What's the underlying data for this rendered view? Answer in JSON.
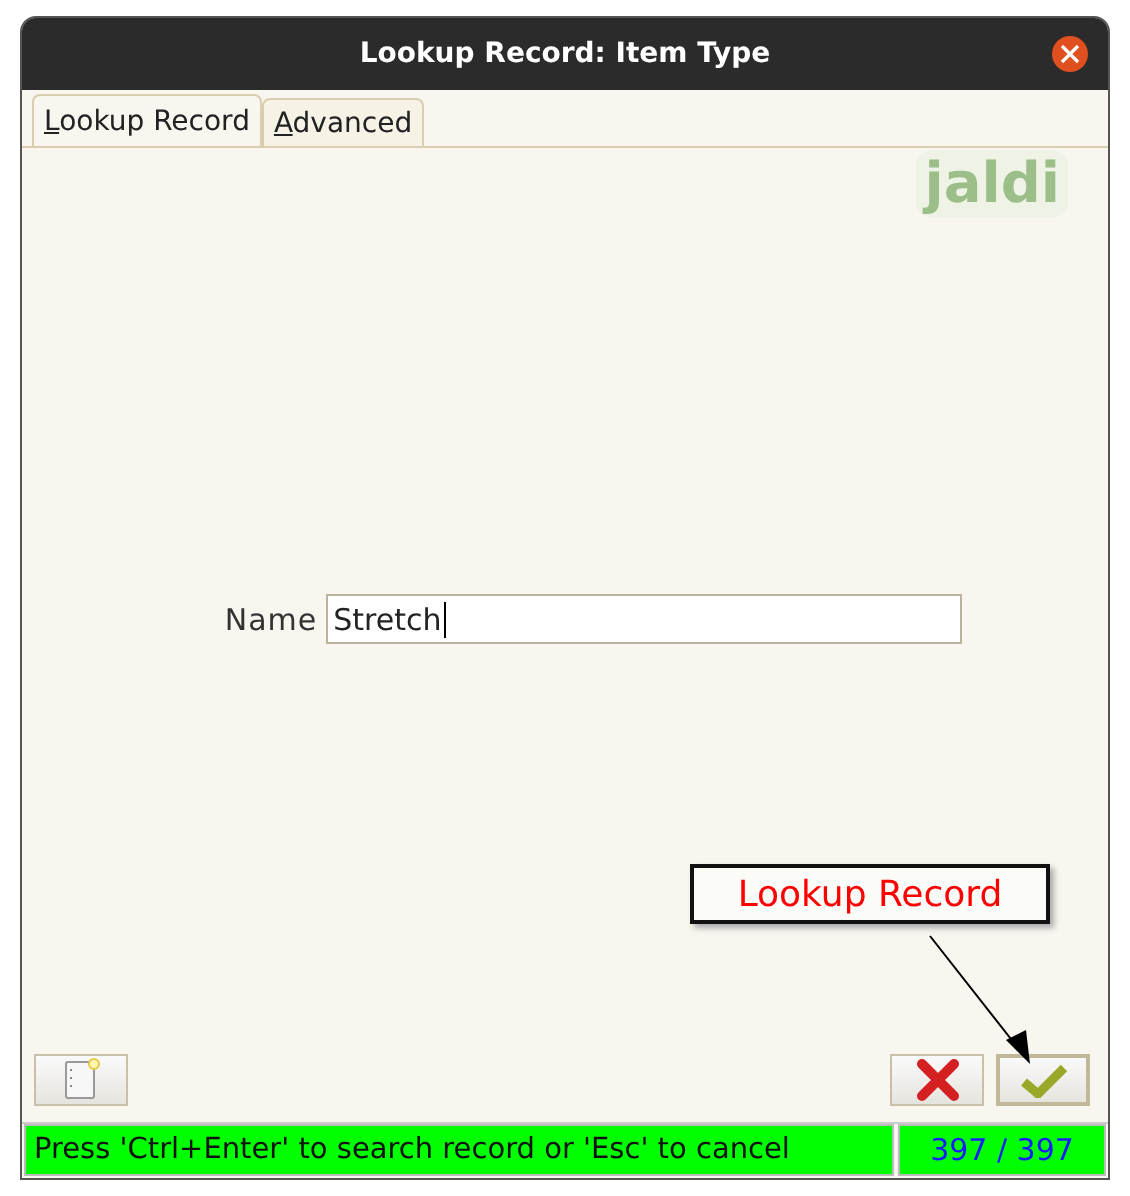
{
  "window": {
    "title": "Lookup Record: Item Type"
  },
  "tabs": [
    {
      "label": "Lookup Record",
      "selected": true
    },
    {
      "label": "Advanced",
      "selected": false
    }
  ],
  "logo": "jaldi",
  "form": {
    "label": "Name",
    "value": "Stretch"
  },
  "callout": "Lookup Record",
  "status_bar": {
    "message": "Press 'Ctrl+Enter' to search record or 'Esc' to cancel",
    "count": "397 / 397"
  }
}
